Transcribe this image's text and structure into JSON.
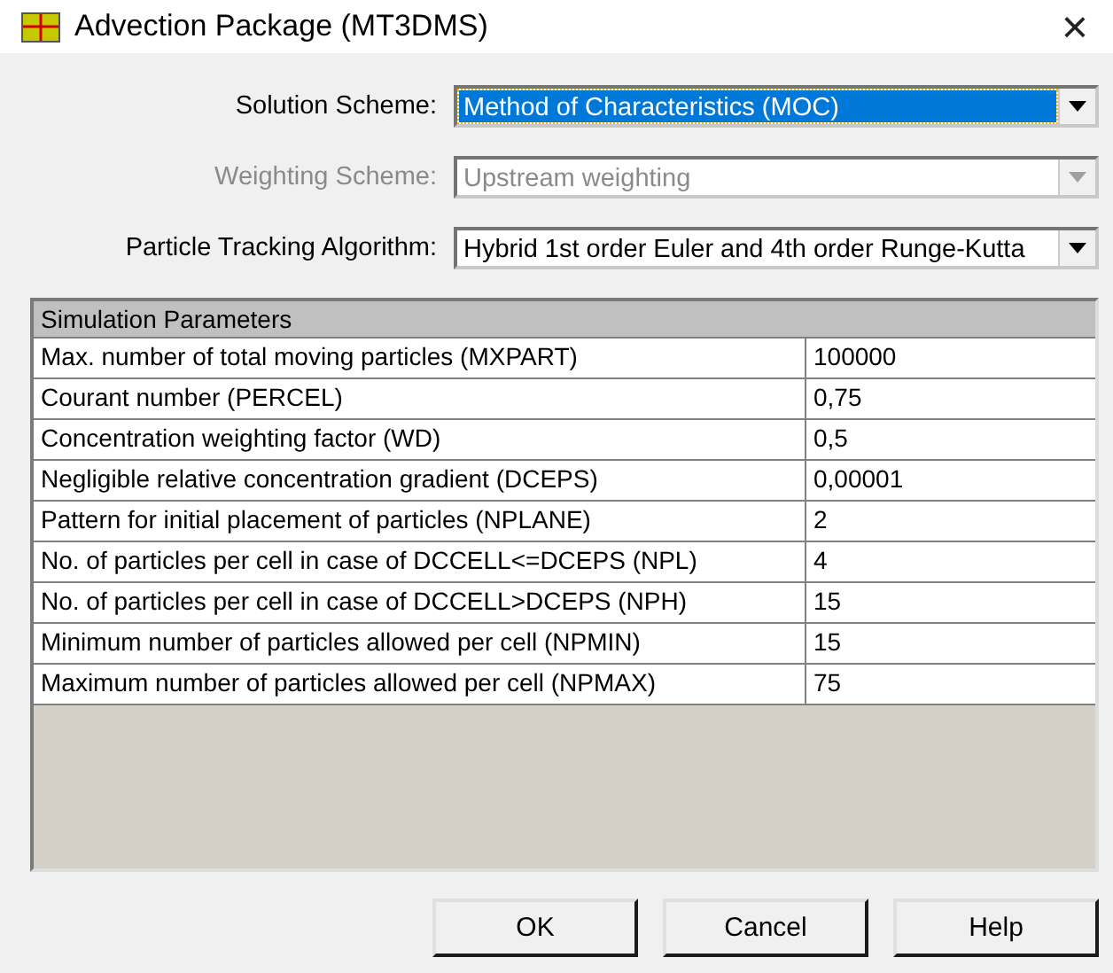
{
  "window": {
    "title": "Advection Package (MT3DMS)",
    "close": "×"
  },
  "fields": [
    {
      "label": "Solution Scheme:",
      "value": "Method of Characteristics (MOC)",
      "selected": true,
      "disabled": false
    },
    {
      "label": "Weighting Scheme:",
      "value": "Upstream weighting",
      "selected": false,
      "disabled": true
    },
    {
      "label": "Particle Tracking Algorithm:",
      "value": "Hybrid 1st order Euler and 4th order Runge-Kutta",
      "selected": false,
      "disabled": false
    }
  ],
  "table": {
    "title": "Simulation Parameters",
    "rows": [
      {
        "name": "Max. number of total moving particles (MXPART)",
        "value": "100000"
      },
      {
        "name": "Courant number (PERCEL)",
        "value": "0,75"
      },
      {
        "name": "Concentration weighting factor (WD)",
        "value": "0,5"
      },
      {
        "name": "Negligible relative concentration gradient (DCEPS)",
        "value": "0,00001"
      },
      {
        "name": "Pattern for initial placement of particles (NPLANE)",
        "value": "2"
      },
      {
        "name": "No. of particles per cell in case of DCCELL<=DCEPS (NPL)",
        "value": "4"
      },
      {
        "name": "No. of particles per cell in case of DCCELL>DCEPS (NPH)",
        "value": "15"
      },
      {
        "name": "Minimum number of particles allowed per cell (NPMIN)",
        "value": "15"
      },
      {
        "name": "Maximum number of particles allowed per cell (NPMAX)",
        "value": "75"
      }
    ]
  },
  "buttons": [
    "OK",
    "Cancel",
    "Help"
  ]
}
